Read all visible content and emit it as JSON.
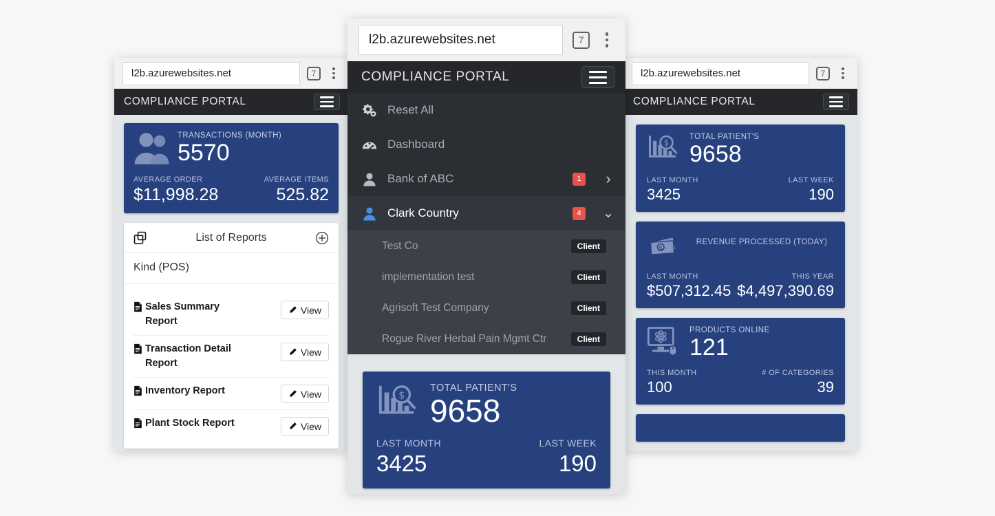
{
  "browser": {
    "url": "l2b.azurewebsites.net",
    "tab_count": "7",
    "menu_icon": "kebab-menu-icon"
  },
  "app": {
    "title": "COMPLIANCE PORTAL",
    "menu_toggle_icon": "hamburger-icon"
  },
  "left_panel": {
    "card": {
      "icon": "two-users-icon",
      "caption": "TRANSACTIONS (MONTH)",
      "value": "5570",
      "left_label": "AVERAGE ORDER",
      "left_value": "$11,998.28",
      "right_label": "AVERAGE ITEMS",
      "right_value": "525.82"
    },
    "reports": {
      "header_icon": "copy-files-icon",
      "title": "List of Reports",
      "add_icon": "plus-circle-icon",
      "kind": "Kind (POS)",
      "items": [
        {
          "icon": "file-report-icon",
          "name": "Sales Summary Report",
          "action": "View",
          "action_icon": "pencil-icon"
        },
        {
          "icon": "file-report-icon",
          "name": "Transaction Detail Report",
          "action": "View",
          "action_icon": "pencil-icon"
        },
        {
          "icon": "file-report-icon",
          "name": "Inventory Report",
          "action": "View",
          "action_icon": "pencil-icon"
        },
        {
          "icon": "file-report-icon",
          "name": "Plant Stock Report",
          "action": "View",
          "action_icon": "pencil-icon"
        }
      ]
    }
  },
  "center_panel": {
    "nav": [
      {
        "icon": "gears-icon",
        "label": "Reset All",
        "badge": "",
        "chevron": "",
        "active": false
      },
      {
        "icon": "dashboard-gauge-icon",
        "label": "Dashboard",
        "badge": "",
        "chevron": "",
        "active": false
      },
      {
        "icon": "user-icon",
        "label": "Bank of ABC",
        "badge": "1",
        "chevron": "›",
        "active": false
      },
      {
        "icon": "user-icon-active",
        "label": "Clark Country",
        "badge": "4",
        "chevron": "⌄",
        "active": true
      }
    ],
    "submenu": [
      {
        "label": "Test Co",
        "badge": "Client"
      },
      {
        "label": "implementation test",
        "badge": "Client"
      },
      {
        "label": "Agrisoft Test Company",
        "badge": "Client"
      },
      {
        "label": "Rogue River Herbal Pain Mgmt Ctr",
        "badge": "Client"
      }
    ],
    "card": {
      "icon": "chart-search-icon",
      "caption": "TOTAL PATIENT'S",
      "value": "9658",
      "left_label": "LAST MONTH",
      "left_value": "3425",
      "right_label": "LAST WEEK",
      "right_value": "190"
    }
  },
  "right_panel": {
    "cards": [
      {
        "icon": "chart-search-icon",
        "caption": "TOTAL PATIENT'S",
        "value": "9658",
        "left_label": "LAST MONTH",
        "left_value": "3425",
        "right_label": "LAST WEEK",
        "right_value": "190"
      },
      {
        "icon": "money-cash-icon",
        "caption": "REVENUE PROCESSED (TODAY)",
        "value": "",
        "left_label": "LAST MONTH",
        "left_value": "$507,312.45",
        "right_label": "THIS YEAR",
        "right_value": "$4,497,390.69"
      },
      {
        "icon": "monitor-mouse-icon",
        "caption": "PRODUCTS ONLINE",
        "value": "121",
        "left_label": "THIS MONTH",
        "left_value": "100",
        "right_label": "# OF CATEGORIES",
        "right_value": "39"
      }
    ]
  },
  "colors": {
    "card_blue": "#27417f",
    "header_dark": "#25272b",
    "nav_dark": "#2b2e33",
    "submenu_dark": "#3b4049",
    "badge_red": "#e8524a",
    "page_bg": "#e2e6e8",
    "canvas": "#f7f7f7"
  }
}
